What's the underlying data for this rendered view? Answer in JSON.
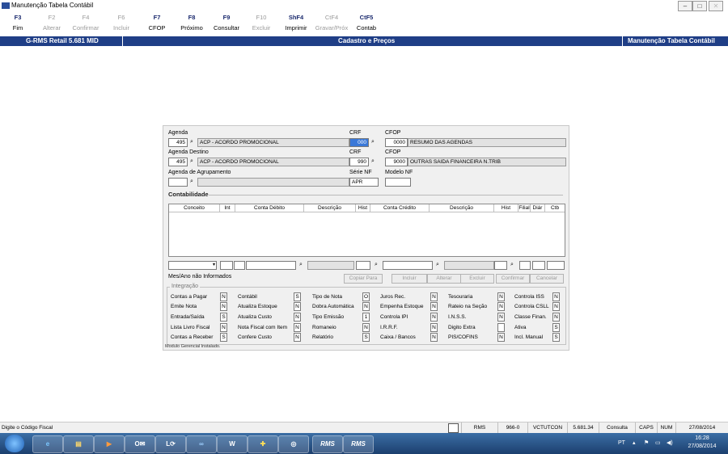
{
  "window": {
    "title": "Manutenção Tabela Contábil"
  },
  "toolbar": {
    "buttons": [
      {
        "key": "F3",
        "label": "Fim",
        "enabled": true
      },
      {
        "key": "F2",
        "label": "Alterar",
        "enabled": false
      },
      {
        "key": "F4",
        "label": "Confirmar",
        "enabled": false
      },
      {
        "key": "F6",
        "label": "Incluir",
        "enabled": false
      },
      {
        "key": "F7",
        "label": "CFOP",
        "enabled": true
      },
      {
        "key": "F8",
        "label": "Próximo",
        "enabled": true
      },
      {
        "key": "F9",
        "label": "Consultar",
        "enabled": true
      },
      {
        "key": "F10",
        "label": "Excluir",
        "enabled": false
      },
      {
        "key": "ShF4",
        "label": "Imprimir",
        "enabled": true
      },
      {
        "key": "CtF4",
        "label": "Gravar/Próx",
        "enabled": false
      },
      {
        "key": "CtF5",
        "label": "Contab",
        "enabled": true
      }
    ]
  },
  "band": {
    "left": "G-RMS Retail 5.681 MID",
    "center": "Cadastro e Preços",
    "right": "Manutenção Tabela Contábil"
  },
  "form": {
    "agenda_label": "Agenda",
    "agenda_code": "495",
    "agenda_desc": "ACP - ACORDO PROMOCIONAL",
    "crf_label": "CRF",
    "crf1": "000",
    "cfop_label": "CFOP",
    "cfop1_code": "0000",
    "cfop1_desc": "RESUMO DAS AGENDAS",
    "agenda_destino_label": "Agenda Destino",
    "destino_code": "495",
    "destino_desc": "ACP - ACORDO PROMOCIONAL",
    "crf2_label": "CRF",
    "crf2": "990",
    "cfop2_label": "CFOP",
    "cfop2_code": "9000",
    "cfop2_desc": "OUTRAS SAIDA FINANCEIRA N.TRIB",
    "agrupamento_label": "Agenda de Agrupamento",
    "agrupamento_code": "",
    "agrupamento_desc": "",
    "serie_label": "Série NF",
    "serie": "APR",
    "modelo_label": "Modelo NF",
    "modelo": ""
  },
  "contabilidade": {
    "title": "Contabilidade",
    "columns": [
      "Conceito",
      "Int",
      "Conta Débito",
      "Descrição",
      "Hist",
      "Conta Crédito",
      "Descrição",
      "Hist",
      "Filial",
      "Diár",
      "Ctb"
    ],
    "message": "Mes/Ano não Informados",
    "buttons": [
      "Copiar Para",
      "Incluir",
      "Alterar",
      "Excluir",
      "Confirmar",
      "Cancelar"
    ]
  },
  "integracao": {
    "title": "Integração",
    "items": [
      {
        "label": "Contas a Pagar",
        "value": "N"
      },
      {
        "label": "Emite Nota",
        "value": "N"
      },
      {
        "label": "Entrada/Saída",
        "value": "S"
      },
      {
        "label": "Lista Livro Fiscal",
        "value": "N"
      },
      {
        "label": "Contas a Receber",
        "value": "S"
      },
      {
        "label": "Contábil",
        "value": "S"
      },
      {
        "label": "Atualiza Estoque",
        "value": "N"
      },
      {
        "label": "Atualiza Custo",
        "value": "N"
      },
      {
        "label": "Nota Fiscal com Item",
        "value": "N"
      },
      {
        "label": "Confere Custo",
        "value": "N"
      },
      {
        "label": "Tipo de Nota",
        "value": "O"
      },
      {
        "label": "Dobra Automática",
        "value": "N"
      },
      {
        "label": "Tipo Emissão",
        "value": "1"
      },
      {
        "label": "Romaneio",
        "value": "N"
      },
      {
        "label": "Relatório",
        "value": "S"
      },
      {
        "label": "Juros Rec.",
        "value": "N"
      },
      {
        "label": "Empenha Estoque",
        "value": "N"
      },
      {
        "label": "Controla IPI",
        "value": "N"
      },
      {
        "label": "I.R.R.F.",
        "value": "N"
      },
      {
        "label": "Caixa / Bancos",
        "value": "N"
      },
      {
        "label": "Tesouraria",
        "value": "N"
      },
      {
        "label": "Rateio na Seção",
        "value": "N"
      },
      {
        "label": "I.N.S.S.",
        "value": "N"
      },
      {
        "label": "Digito Extra",
        "value": ""
      },
      {
        "label": "PIS/COFINS",
        "value": "N"
      },
      {
        "label": "Controla ISS",
        "value": "N"
      },
      {
        "label": "Controla CSLL",
        "value": "N"
      },
      {
        "label": "Classe Finan.",
        "value": "N"
      },
      {
        "label": "Ativa",
        "value": "S"
      },
      {
        "label": "Incl. Manual",
        "value": "S"
      }
    ],
    "footer": "Modulo Gerencial Instalado."
  },
  "status": {
    "message": "Digite o Código Fiscal",
    "cells": [
      "RMS",
      "966-0",
      "VCTUTCON",
      "5.681.34",
      "Consulta",
      "CAPS",
      "NUM",
      "27/08/2014"
    ]
  },
  "taskbar": {
    "apps": [
      "start",
      "ie",
      "explorer",
      "media",
      "outlook",
      "lync",
      "app",
      "word",
      "app2",
      "app3",
      "RMS",
      "RMS"
    ],
    "tray_lang": "PT",
    "time": "16:28",
    "date": "27/08/2014"
  }
}
